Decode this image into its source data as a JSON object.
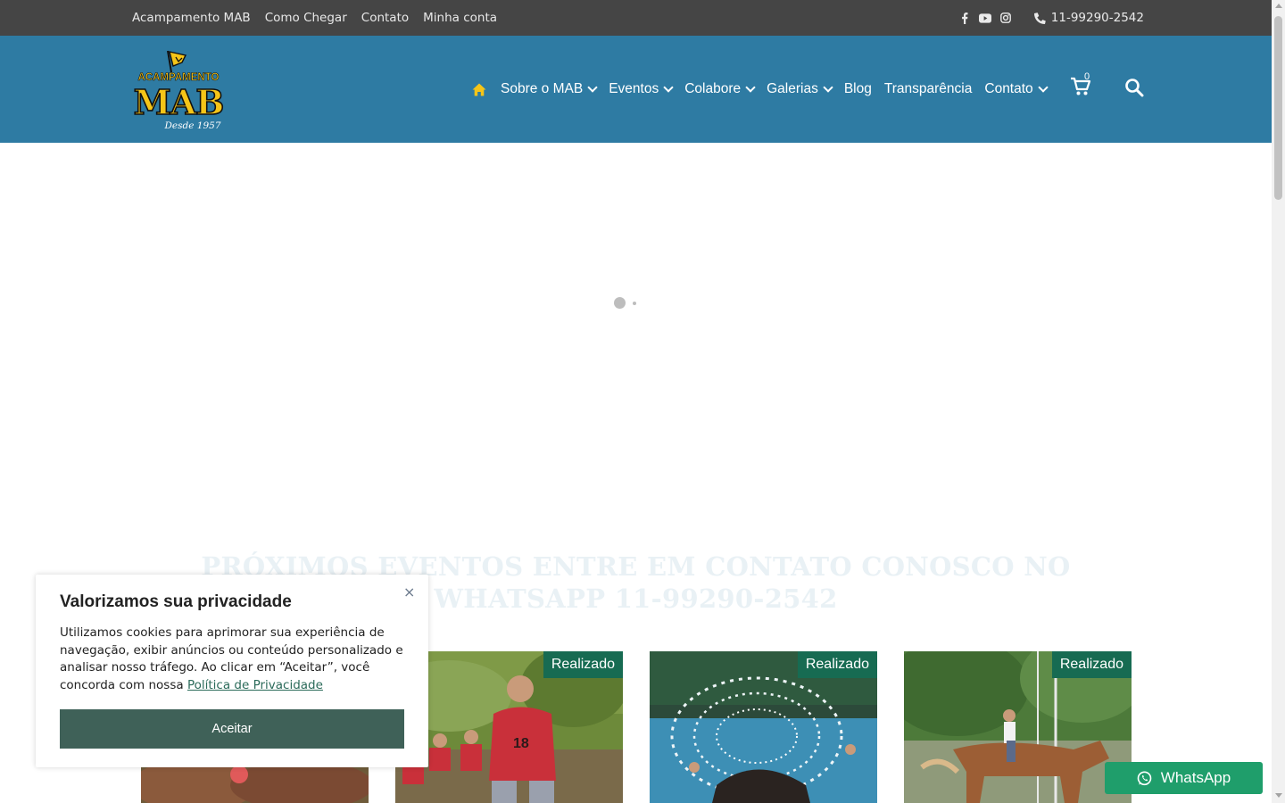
{
  "topbar": {
    "links": [
      "Acampamento MAB",
      "Como Chegar",
      "Contato",
      "Minha conta"
    ],
    "social_icons": [
      "facebook-icon",
      "youtube-icon",
      "instagram-icon"
    ],
    "phone": "11-99290-2542"
  },
  "header": {
    "logo": {
      "text_top": "ACAMPAMENTO",
      "text_main": "MAB",
      "text_sub": "Desde 1957"
    },
    "nav": {
      "home_icon": "home-icon",
      "items": [
        {
          "label": "Sobre o MAB",
          "dropdown": true
        },
        {
          "label": "Eventos",
          "dropdown": true
        },
        {
          "label": "Colabore",
          "dropdown": true
        },
        {
          "label": "Galerias",
          "dropdown": true
        },
        {
          "label": "Blog",
          "dropdown": false
        },
        {
          "label": "Transparência",
          "dropdown": false
        },
        {
          "label": "Contato",
          "dropdown": true
        }
      ]
    },
    "cart": {
      "icon": "cart-icon",
      "count": "0"
    },
    "search_icon": "search-icon"
  },
  "main": {
    "heading": "PRÓXIMOS EVENTOS ENTRE EM CONTATO CONOSCO NO WHATSAPP 11-99290-2542",
    "events": [
      {
        "badge": ""
      },
      {
        "badge": "Realizado"
      },
      {
        "badge": "Realizado"
      },
      {
        "badge": "Realizado"
      }
    ]
  },
  "cookie_banner": {
    "title": "Valorizamos sua privacidade",
    "close_label": "×",
    "text": "Utilizamos cookies para aprimorar sua experiência de navegação, exibir anúncios ou conteúdo personalizado e analisar nosso tráfego. Ao clicar em “Aceitar”, você concorda com nossa",
    "link_text": "Política de Privacidade",
    "accept_label": "Aceitar"
  },
  "whatsapp": {
    "label": "WhatsApp"
  },
  "colors": {
    "topbar": "#454545",
    "header": "#2e7ba3",
    "badge": "#176b52",
    "accept_button": "#3f6158",
    "whatsapp": "#1f9e6b",
    "home_icon": "#f5c518"
  }
}
